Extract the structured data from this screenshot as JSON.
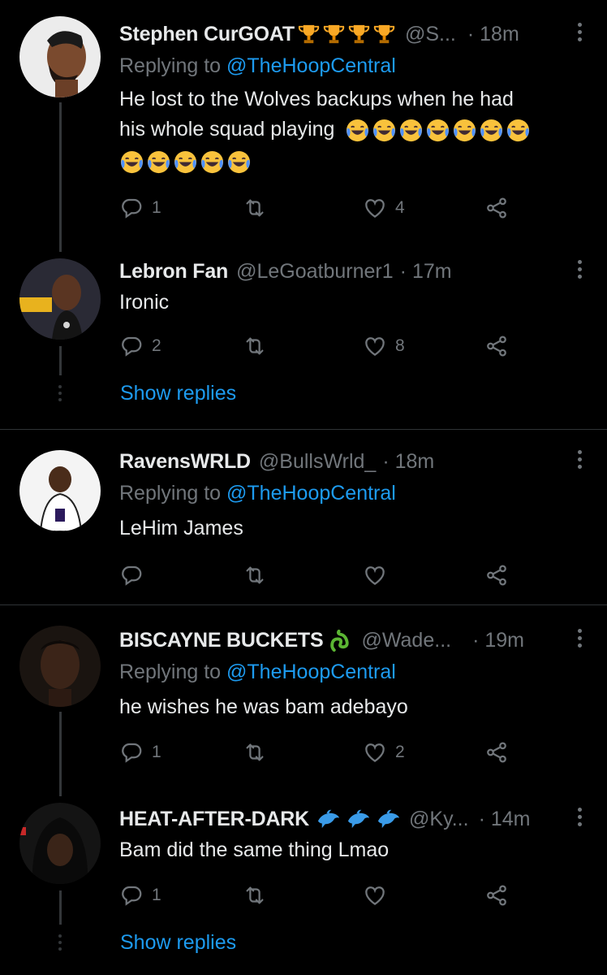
{
  "colors": {
    "background": "#000000",
    "text": "#e7e9ea",
    "muted": "#71767b",
    "link": "#1d9bf0",
    "line": "#333639"
  },
  "tweets": [
    {
      "name": "Stephen CurGOAT",
      "name_emojis": "🏆🏆🏆🏆",
      "handle": "@S...",
      "time": "· 18m",
      "replying_prefix": "Replying to ",
      "replying_to": "@TheHoopCentral",
      "text_line1": "He lost to the Wolves backups when he had",
      "text_line2": "his whole squad playing",
      "text_emojis": "😂😂😂😂😂😂😂😂😂😂😂😂",
      "reply_count": "1",
      "retweet_count": "",
      "like_count": "4"
    },
    {
      "name": "Lebron Fan",
      "handle": "@LeGoatburner1",
      "time": "· 17m",
      "text": "Ironic",
      "reply_count": "2",
      "retweet_count": "",
      "like_count": "8",
      "show_replies": "Show replies"
    },
    {
      "name": "RavensWRLD",
      "handle": "@BullsWrld_",
      "time": "· 18m",
      "replying_prefix": "Replying to ",
      "replying_to": "@TheHoopCentral",
      "text": "LeHim James",
      "reply_count": "",
      "retweet_count": "",
      "like_count": ""
    },
    {
      "name": "BISCAYNE BUCKETS",
      "name_emoji_icon": "snake-icon",
      "handle": "@Wade...",
      "time": "· 19m",
      "replying_prefix": "Replying to ",
      "replying_to": "@TheHoopCentral",
      "text": "he wishes he was bam adebayo",
      "reply_count": "1",
      "retweet_count": "",
      "like_count": "2"
    },
    {
      "name": "HEAT-AFTER-DARK",
      "name_emojis": "🐬🐬🐬",
      "handle": "@Ky...",
      "time": "· 14m",
      "text": "Bam did the same thing Lmao",
      "reply_count": "1",
      "retweet_count": "",
      "like_count": "",
      "show_replies": "Show replies"
    }
  ]
}
